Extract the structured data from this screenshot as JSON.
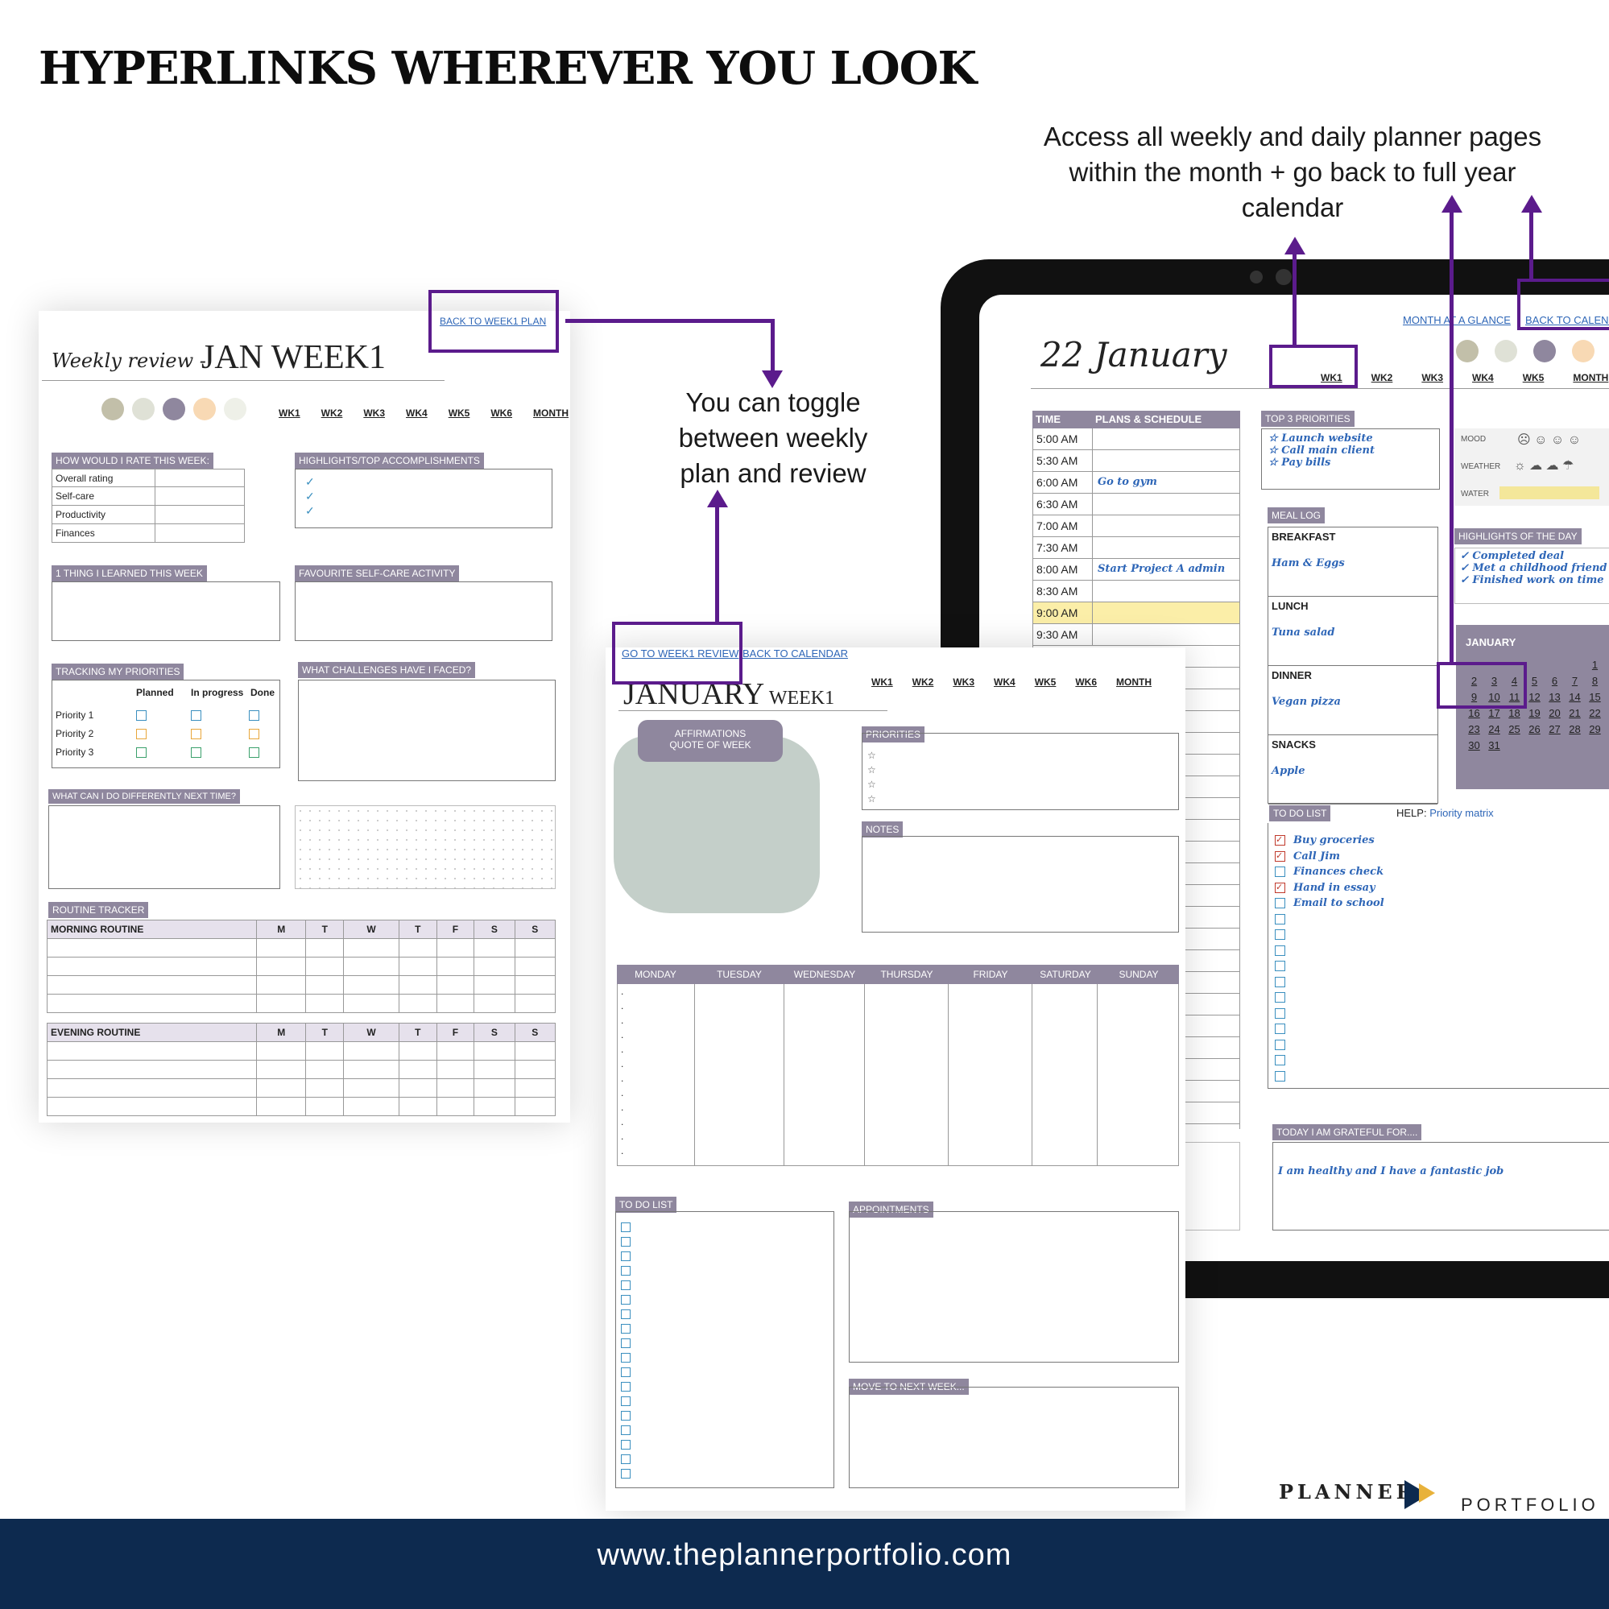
{
  "headline": "HYPERLINKS WHEREVER YOU LOOK",
  "annotations": {
    "right_note_lines": [
      "Access all weekly and daily planner pages",
      "within the month + go back to full year",
      "calendar"
    ],
    "center_note_lines": [
      "You can toggle",
      "between weekly",
      "plan and review"
    ]
  },
  "review_page": {
    "link": "BACK TO WEEK1 PLAN",
    "script_title": "Weekly review -",
    "title": "JAN WEEK1",
    "weeks": [
      "WK1",
      "WK2",
      "WK3",
      "WK4",
      "WK5",
      "WK6",
      "MONTH"
    ],
    "rate_header": "HOW WOULD I RATE THIS WEEK:",
    "rate_rows": [
      "Overall rating",
      "Self-care",
      "Productivity",
      "Finances"
    ],
    "highlights_header": "HIGHLIGHTS/TOP ACCOMPLISHMENTS",
    "learned_header": "1 THING I LEARNED THIS WEEK",
    "selfcare_header": "FAVOURITE SELF-CARE ACTIVITY",
    "tracking_header": "TRACKING MY PRIORITIES",
    "tracking_cols": [
      "Planned",
      "In progress",
      "Done"
    ],
    "tracking_rows": [
      "Priority 1",
      "Priority 2",
      "Priority 3"
    ],
    "challenges_header": "WHAT CHALLENGES HAVE I FACED?",
    "differently_header": "WHAT CAN I DO DIFFERENTLY NEXT TIME?",
    "routine_header": "ROUTINE TRACKER",
    "morning": "MORNING ROUTINE",
    "evening": "EVENING ROUTINE",
    "days": [
      "M",
      "T",
      "W",
      "T",
      "F",
      "S",
      "S"
    ],
    "colors": [
      "#c2bfa9",
      "#dfe1d6",
      "#8f879e",
      "#f8d9b4",
      "#eef0e8"
    ]
  },
  "week_page": {
    "link_review": "GO TO WEEK1 REVIEW",
    "link_calendar": "BACK TO CALENDAR",
    "title": "JANUARY",
    "subtitle": "WEEK1",
    "weeks": [
      "WK1",
      "WK2",
      "WK3",
      "WK4",
      "WK5",
      "WK6",
      "MONTH"
    ],
    "affirmations": "AFFIRMATIONS",
    "quote": "QUOTE OF WEEK",
    "priorities": "PRIORITIES",
    "notes": "NOTES",
    "days": [
      "MONDAY",
      "TUESDAY",
      "WEDNESDAY",
      "THURSDAY",
      "FRIDAY",
      "SATURDAY",
      "SUNDAY"
    ],
    "todo": "TO DO LIST",
    "appointments": "APPOINTMENTS",
    "move": "MOVE TO NEXT WEEK..."
  },
  "daily_page": {
    "link_month": "MONTH AT A GLANCE",
    "link_calendar": "BACK TO CALENDAR",
    "title": "22 January",
    "weeks": [
      "WK1",
      "WK2",
      "WK3",
      "WK4",
      "WK5",
      "MONTH"
    ],
    "time_header": "TIME",
    "plans_header": "PLANS & SCHEDULE",
    "times": [
      "5:00 AM",
      "5:30 AM",
      "6:00 AM",
      "6:30 AM",
      "7:00 AM",
      "7:30 AM",
      "8:00 AM",
      "8:30 AM",
      "9:00 AM",
      "9:30 AM"
    ],
    "plans": [
      "",
      "",
      "Go to gym",
      "",
      "",
      "",
      "Start Project A admin",
      "",
      "",
      ""
    ],
    "top3_header": "TOP 3 PRIORITIES",
    "top3": [
      "Launch website",
      "Call main client",
      "Pay bills"
    ],
    "mood": "MOOD",
    "weather": "WEATHER",
    "water": "WATER",
    "meal_header": "MEAL LOG",
    "meals": [
      {
        "label": "BREAKFAST",
        "value": "Ham & Eggs"
      },
      {
        "label": "LUNCH",
        "value": "Tuna salad"
      },
      {
        "label": "DINNER",
        "value": "Vegan pizza"
      },
      {
        "label": "SNACKS",
        "value": "Apple"
      }
    ],
    "highlights_header": "HIGHLIGHTS OF THE DAY",
    "highlights": [
      "Completed deal",
      "Met a childhood friend",
      "Finished work on time"
    ],
    "mini_cal_title": "JANUARY",
    "mini_cal_rows": [
      [
        "",
        "",
        "",
        "",
        "",
        "",
        "1"
      ],
      [
        "2",
        "3",
        "4",
        "5",
        "6",
        "7",
        "8"
      ],
      [
        "9",
        "10",
        "11",
        "12",
        "13",
        "14",
        "15"
      ],
      [
        "16",
        "17",
        "18",
        "19",
        "20",
        "21",
        "22"
      ],
      [
        "23",
        "24",
        "25",
        "26",
        "27",
        "28",
        "29"
      ],
      [
        "30",
        "31",
        "",
        "",
        "",
        "",
        ""
      ]
    ],
    "todo_header": "TO DO LIST",
    "help_label": "HELP:",
    "help_link": "Priority matrix",
    "todos": [
      "Buy groceries",
      "Call Jim",
      "Finances check",
      "Hand in essay",
      "Email to school"
    ],
    "todo_checked": [
      true,
      true,
      false,
      true,
      false
    ],
    "grateful_header": "TODAY I AM GRATEFUL FOR....",
    "grateful_text": "I am healthy and I have a fantastic job"
  },
  "brand": {
    "left": "PLANNER",
    "right": "PORTFOLIO"
  },
  "footer_url": "www.theplannerportfolio.com"
}
